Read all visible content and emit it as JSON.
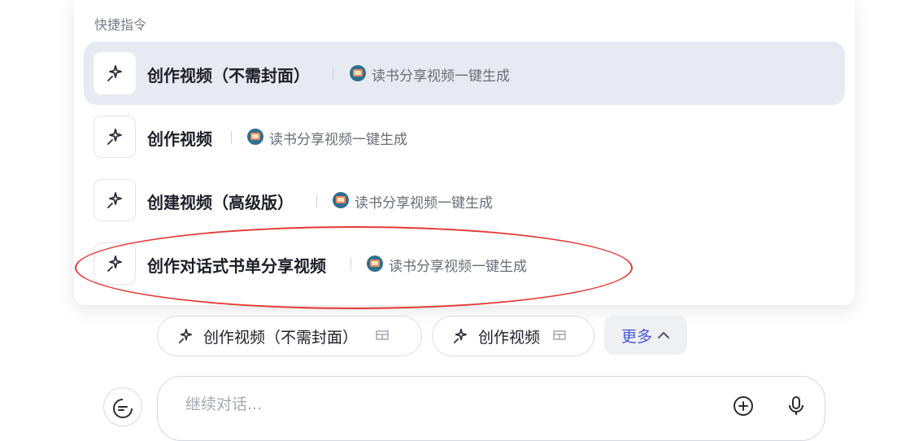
{
  "panel": {
    "title": "快捷指令",
    "commands": [
      {
        "name": "创作视频（不需封面）",
        "bot": "读书分享视频一键生成",
        "selected": true
      },
      {
        "name": "创作视频",
        "bot": "读书分享视频一键生成",
        "selected": false
      },
      {
        "name": "创建视频（高级版）",
        "bot": "读书分享视频一键生成",
        "selected": false
      },
      {
        "name": "创作对话式书单分享视频",
        "bot": "读书分享视频一键生成",
        "selected": false
      }
    ]
  },
  "chips": [
    {
      "label": "创作视频（不需封面）"
    },
    {
      "label": "创作视频"
    }
  ],
  "more": {
    "label": "更多"
  },
  "input": {
    "placeholder": "继续对话..."
  },
  "colors": {
    "accent": "#4a55d6",
    "highlight": "#e8eaf1",
    "annotation": "#e53935"
  },
  "icons": {
    "command": "sparkle-icon",
    "bot": "bot-avatar",
    "chip_trailing": "table-icon",
    "more": "chevron-up-icon",
    "new_chat": "new-chat-icon",
    "add": "plus-circle-icon",
    "voice": "microphone-icon"
  }
}
